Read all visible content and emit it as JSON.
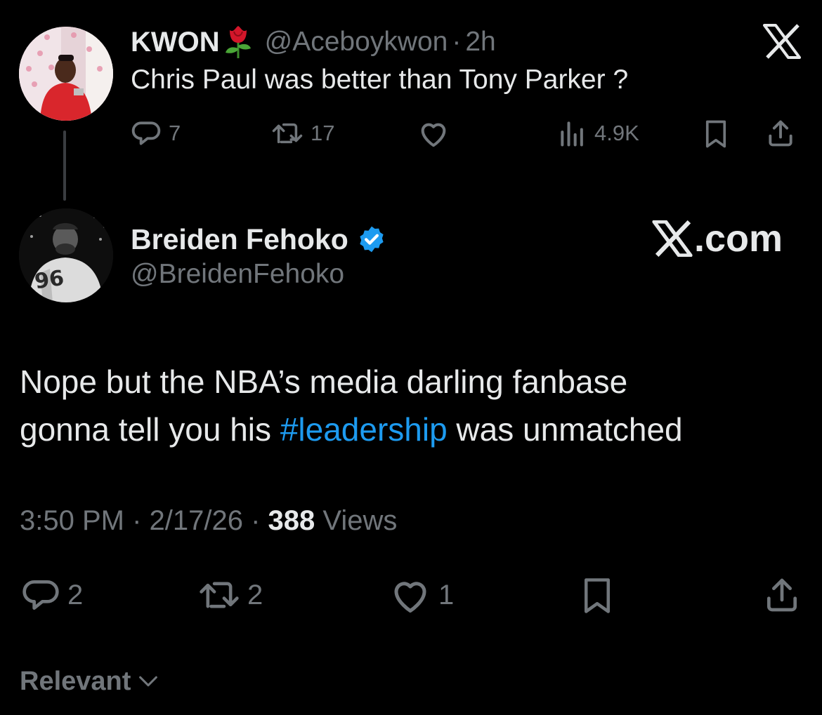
{
  "parent_tweet": {
    "display_name": "KWON",
    "emoji_icon": "rose-icon",
    "handle": "@Aceboykwon",
    "separator": "·",
    "age": "2h",
    "text": "Chris Paul was better than Tony Parker ?",
    "actions": {
      "replies": "7",
      "retweets": "17",
      "likes": "",
      "views": "4.9K"
    }
  },
  "main_tweet": {
    "display_name": "Breiden Fehoko",
    "verified": true,
    "handle": "@BreidenFehoko",
    "text_line1": "Nope but the NBA’s media darling fanbase",
    "text_line2_before": "gonna tell you his ",
    "hashtag": "#leadership",
    "text_line2_after": " was unmatched",
    "time": "3:50 PM",
    "dot1": " · ",
    "date": "2/17/26",
    "dot2": " · ",
    "views_count": "388",
    "views_label": " Views",
    "actions": {
      "replies": "2",
      "retweets": "2",
      "likes": "1"
    }
  },
  "watermark": {
    "logo_icon": "x-logo-icon",
    "text": ".com"
  },
  "sort": {
    "label": "Relevant"
  },
  "colors": {
    "background": "#000000",
    "text": "#e7e9ea",
    "muted": "#71767b",
    "accent": "#1d9bf0"
  }
}
